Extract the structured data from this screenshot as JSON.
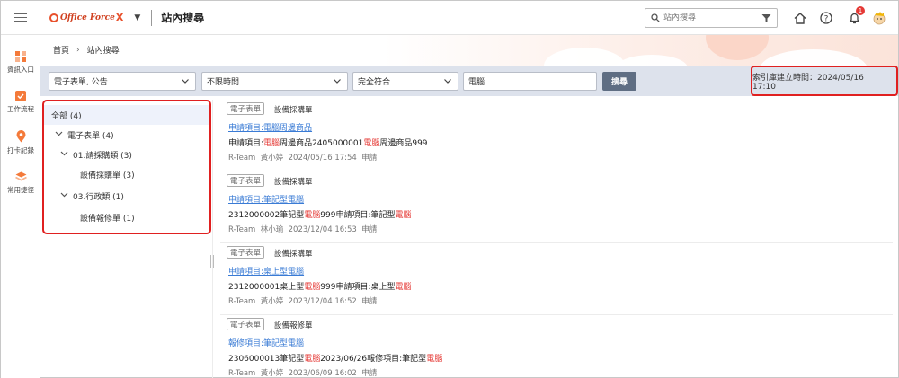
{
  "header": {
    "logo_text": "Office Force",
    "logo_x": "X",
    "app_title": "站內搜尋",
    "search_placeholder": "站內搜尋",
    "notification_count": "1"
  },
  "rail": [
    {
      "label": "資訊入口",
      "icon": "grid-icon",
      "color": "#f47a3a"
    },
    {
      "label": "工作流程",
      "icon": "checkbox-icon",
      "color": "#f47a3a"
    },
    {
      "label": "打卡記錄",
      "icon": "location-pin-icon",
      "color": "#f47a3a"
    },
    {
      "label": "常用捷徑",
      "icon": "layers-icon",
      "color": "#f47a3a"
    }
  ],
  "breadcrumb": {
    "home": "首頁",
    "current": "站內搜尋"
  },
  "filters": {
    "category": "電子表單, 公告",
    "time": "不限時間",
    "match": "完全符合",
    "keyword": "電腦",
    "search_label": "搜尋",
    "index_time": "索引庫建立時間：2024/05/16 17:10"
  },
  "tree": [
    {
      "label": "全部 (4)",
      "level": 0,
      "expanded": null
    },
    {
      "label": "電子表單 (4)",
      "level": 1,
      "expanded": true
    },
    {
      "label": "01.請採購類 (3)",
      "level": 2,
      "expanded": true
    },
    {
      "label": "設備採購單 (3)",
      "level": 3,
      "expanded": null
    },
    {
      "label": "03.行政類 (1)",
      "level": 2,
      "expanded": true
    },
    {
      "label": "設備報修單 (1)",
      "level": 3,
      "expanded": null
    }
  ],
  "results": [
    {
      "tag": "電子表單",
      "form": "設備採購單",
      "link": "申請項目:電腦周邊商品",
      "desc_parts": [
        "申請項目:",
        "電腦",
        "周邊商品2405000001",
        "電腦",
        "周邊商品999"
      ],
      "meta": "R-Team  黃小婷  2024/05/16 17:54  申請"
    },
    {
      "tag": "電子表單",
      "form": "設備採購單",
      "link": "申請項目:筆記型電腦",
      "desc_parts": [
        "2312000002筆記型",
        "電腦",
        "999申請項目:筆記型",
        "電腦",
        ""
      ],
      "meta": "R-Team  林小瑜  2023/12/04 16:53  申請"
    },
    {
      "tag": "電子表單",
      "form": "設備採購單",
      "link": "申請項目:桌上型電腦",
      "desc_parts": [
        "2312000001桌上型",
        "電腦",
        "999申請項目:桌上型",
        "電腦",
        ""
      ],
      "meta": "R-Team  黃小婷  2023/12/04 16:52  申請"
    },
    {
      "tag": "電子表單",
      "form": "設備報修單",
      "link": "報修項目:筆記型電腦",
      "desc_parts": [
        "2306000013筆記型",
        "電腦",
        "2023/06/26報修項目:筆記型",
        "電腦",
        ""
      ],
      "meta": "R-Team  黃小婷  2023/06/09 16:02  申請"
    }
  ]
}
